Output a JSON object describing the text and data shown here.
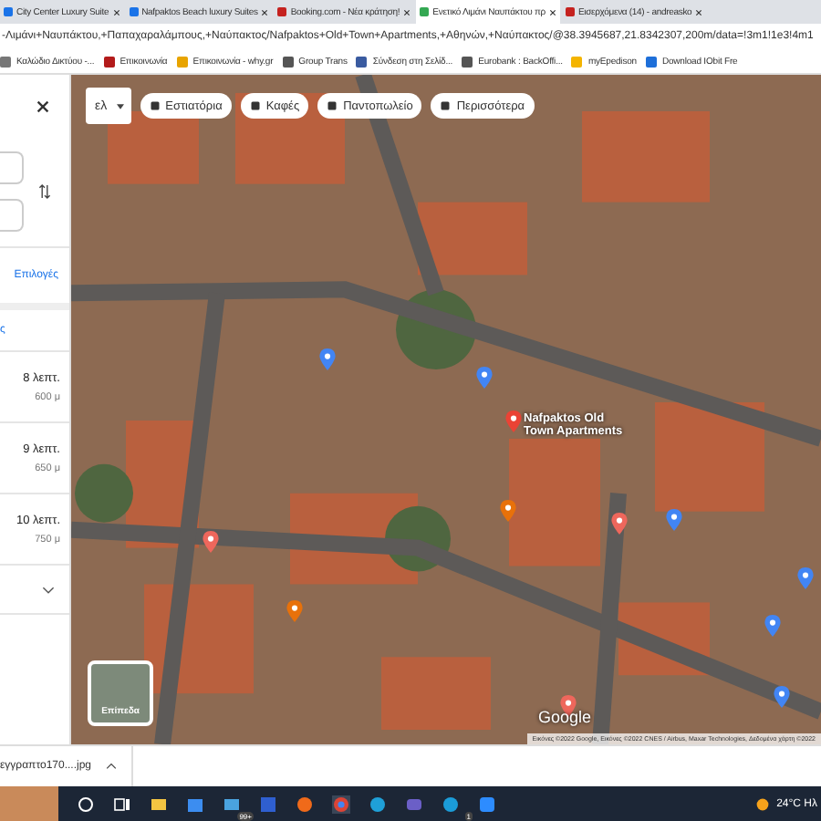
{
  "browser": {
    "tabs": [
      {
        "title": "City Center Luxury Suite",
        "selected": false
      },
      {
        "title": "Nafpaktos Beach luxury Suites",
        "selected": false
      },
      {
        "title": "Booking.com - Νέα κράτηση!",
        "selected": false
      },
      {
        "title": "Ενετικό Λιμάνι Ναυπάκτου πρ",
        "selected": true
      },
      {
        "title": "Εισερχόμενα (14) - andreasko",
        "selected": false
      }
    ],
    "address": "-Λιμάνι+Ναυπάκτου,+Παπαχαραλάμπους,+Ναύπακτος/Nafpaktos+Old+Town+Apartments,+Αθηνών,+Ναύπακτος/@38.3945687,21.8342307,200m/data=!3m1!1e3!4m1",
    "bookmarks": [
      "Καλώδιο Δικτύου -...",
      "Επικοινωνία",
      "Επικοινωνία - why.gr",
      "Group Trans",
      "Σύνδεση στη Σελίδ...",
      "Eurobank : BackOffi...",
      "myEpedison",
      "Download IObit Fre"
    ]
  },
  "directions": {
    "options_link": "Επιλογές",
    "partial_label": "ς",
    "routes": [
      {
        "duration": "8 λεπτ.",
        "distance": "600 μ"
      },
      {
        "duration": "9 λεπτ.",
        "distance": "650 μ"
      },
      {
        "duration": "10 λεπτ.",
        "distance": "750 μ"
      }
    ]
  },
  "map": {
    "language": "ελ",
    "chips": [
      "Εστιατόρια",
      "Καφές",
      "Παντοπωλείο",
      "Περισσότερα"
    ],
    "place_label": "Nafpaktos Old Town Apartments",
    "pins": [
      {
        "color": "#ea4335"
      },
      {
        "color": "#4285f4"
      },
      {
        "color": "#4285f4"
      },
      {
        "color": "#e8710a"
      },
      {
        "color": "#e8710a"
      },
      {
        "color": "#ee675c"
      },
      {
        "color": "#4285f4"
      },
      {
        "color": "#4285f4"
      },
      {
        "color": "#4285f4"
      },
      {
        "color": "#ee675c"
      },
      {
        "color": "#4285f4"
      },
      {
        "color": "#ee675c"
      }
    ],
    "layers_label": "Επίπεδα",
    "logo": "Google",
    "attribution": "Εικόνες ©2022 Google, Εικόνες ©2022 CNES / Airbus, Maxar Technologies, Δεδομένα χάρτη ©2022"
  },
  "download": {
    "file": "εγγραπτο170....jpg"
  },
  "taskbar": {
    "mail_badge": "99+",
    "skype_badge": "1",
    "weather": "24°C Ηλ"
  }
}
